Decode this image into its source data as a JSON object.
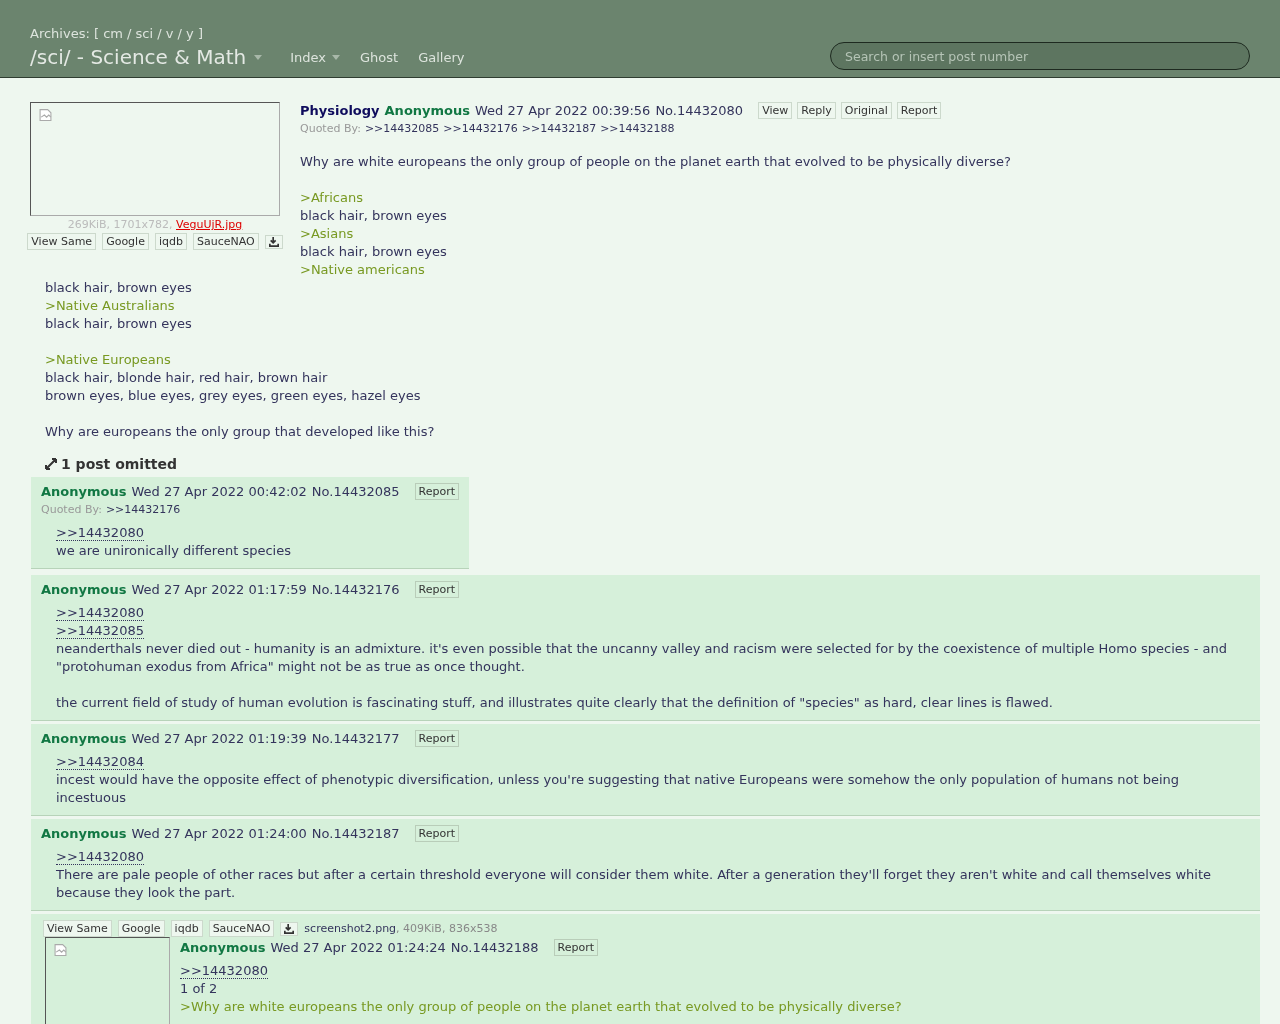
{
  "header": {
    "archives": "Archives: [ cm / sci / v / y ]",
    "board_title": "/sci/ - Science & Math",
    "nav": [
      {
        "label": "Index",
        "dropdown": true
      },
      {
        "label": "Ghost",
        "dropdown": false
      },
      {
        "label": "Gallery",
        "dropdown": false
      }
    ],
    "search": {
      "placeholder": "Search or insert post number"
    }
  },
  "op": {
    "file": {
      "info": "269KiB, 1701x782,",
      "name": "VeguUjR.jpg",
      "tools": [
        "View Same",
        "Google",
        "iqdb",
        "SauceNAO"
      ]
    },
    "subject": "Physiology",
    "name": "Anonymous",
    "date": "Wed 27 Apr 2022 00:39:56",
    "number": "No.14432080",
    "actions": [
      "View",
      "Reply",
      "Original",
      "Report"
    ],
    "quoted_by_label": "Quoted By:",
    "quoted_by": [
      ">>14432085",
      ">>14432176",
      ">>14432187",
      ">>14432188"
    ],
    "lines": [
      {
        "kind": "text",
        "text": "Why are white europeans the only group of people on the planet earth that evolved to be physically diverse?"
      },
      {
        "kind": "gap"
      },
      {
        "kind": "quote",
        "text": ">Africans"
      },
      {
        "kind": "text",
        "text": "black hair, brown eyes"
      },
      {
        "kind": "quote",
        "text": ">Asians"
      },
      {
        "kind": "text",
        "text": "black hair, brown eyes"
      },
      {
        "kind": "quote",
        "text": ">Native americans"
      },
      {
        "kind": "text",
        "text": "black hair, brown eyes"
      },
      {
        "kind": "quote",
        "text": ">Native Australians"
      },
      {
        "kind": "text",
        "text": "black hair, brown eyes"
      },
      {
        "kind": "gap"
      },
      {
        "kind": "quote",
        "text": ">Native Europeans"
      },
      {
        "kind": "text",
        "text": "black hair, blonde hair, red hair, brown hair"
      },
      {
        "kind": "text",
        "text": "brown eyes, blue eyes, grey eyes, green eyes, hazel eyes"
      },
      {
        "kind": "gap"
      },
      {
        "kind": "text",
        "text": "Why are europeans the only group that developed like this?"
      }
    ]
  },
  "omitted": "1 post omitted",
  "replies": [
    {
      "name": "Anonymous",
      "date": "Wed 27 Apr 2022 00:42:02",
      "number": "No.14432085",
      "actions": [
        "Report"
      ],
      "quoted_by_label": "Quoted By:",
      "quoted_by": [
        ">>14432176"
      ],
      "lines": [
        {
          "kind": "link",
          "text": ">>14432080"
        },
        {
          "kind": "text",
          "text": "we are unironically different species"
        }
      ]
    },
    {
      "name": "Anonymous",
      "date": "Wed 27 Apr 2022 01:17:59",
      "number": "No.14432176",
      "actions": [
        "Report"
      ],
      "lines": [
        {
          "kind": "link",
          "text": ">>14432080"
        },
        {
          "kind": "link",
          "text": ">>14432085"
        },
        {
          "kind": "text",
          "text": "neanderthals never died out - humanity is an admixture. it's even possible that the uncanny valley and racism were selected for by the coexistence of multiple Homo species - and \"protohuman exodus from Africa\" might not be as true as once thought."
        },
        {
          "kind": "gap"
        },
        {
          "kind": "text",
          "text": "the current field of study of human evolution is fascinating stuff, and illustrates quite clearly that the definition of \"species\" as hard, clear lines is flawed."
        }
      ]
    },
    {
      "name": "Anonymous",
      "date": "Wed 27 Apr 2022 01:19:39",
      "number": "No.14432177",
      "actions": [
        "Report"
      ],
      "lines": [
        {
          "kind": "link",
          "text": ">>14432084"
        },
        {
          "kind": "text",
          "text": "incest would have the opposite effect of phenotypic diversification, unless you're suggesting that native Europeans were somehow the only population of humans not being incestuous"
        }
      ]
    },
    {
      "name": "Anonymous",
      "date": "Wed 27 Apr 2022 01:24:00",
      "number": "No.14432187",
      "actions": [
        "Report"
      ],
      "lines": [
        {
          "kind": "link",
          "text": ">>14432080"
        },
        {
          "kind": "text",
          "text": "There are pale people of other races but after a certain threshold everyone will consider them white. After a generation they'll forget they aren't white and call themselves white because they look the part."
        }
      ]
    },
    {
      "name": "Anonymous",
      "date": "Wed 27 Apr 2022 01:24:24",
      "number": "No.14432188",
      "actions": [
        "Report"
      ],
      "file": {
        "tools": [
          "View Same",
          "Google",
          "iqdb",
          "SauceNAO"
        ],
        "name": "screenshot2.png",
        "info": ", 409KiB, 836x538"
      },
      "lines": [
        {
          "kind": "link",
          "text": ">>14432080"
        },
        {
          "kind": "text",
          "text": "1 of 2"
        },
        {
          "kind": "quote",
          "text": ">Why are white europeans the only group of people on the planet earth that evolved to be physically diverse?"
        }
      ]
    }
  ]
}
